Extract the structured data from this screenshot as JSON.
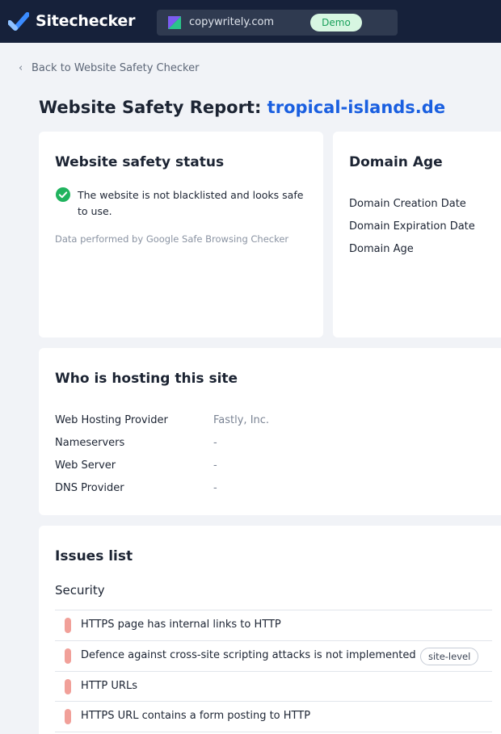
{
  "header": {
    "brand": "Sitechecker",
    "project": "copywritely.com",
    "demo_badge": "Demo"
  },
  "back_link": "Back to Website Safety Checker",
  "title": {
    "prefix": "Website Safety Report:",
    "domain": "tropical-islands.de"
  },
  "safety": {
    "heading": "Website safety status",
    "status_text": "The website is not blacklisted and looks safe to use.",
    "source": "Data performed by Google Safe Browsing Checker"
  },
  "domain_age": {
    "heading": "Domain Age",
    "rows": [
      "Domain Creation Date",
      "Domain Expiration Date",
      "Domain Age"
    ]
  },
  "hosting": {
    "heading": "Who is hosting this site",
    "rows": [
      {
        "label": "Web Hosting Provider",
        "value": "Fastly, Inc."
      },
      {
        "label": "Nameservers",
        "value": "-"
      },
      {
        "label": "Web Server",
        "value": "-"
      },
      {
        "label": "DNS Provider",
        "value": "-"
      }
    ]
  },
  "issues": {
    "heading": "Issues list",
    "section": "Security",
    "items": [
      {
        "text": "HTTPS page has internal links to HTTP",
        "badge": ""
      },
      {
        "text": "Defence against cross-site scripting attacks is not implemented",
        "badge": "site-level"
      },
      {
        "text": "HTTP URLs",
        "badge": ""
      },
      {
        "text": "HTTPS URL contains a form posting to HTTP",
        "badge": ""
      }
    ]
  },
  "colors": {
    "topbar": "#16213a",
    "accent_link": "#1a5fe0",
    "safe_green": "#20b35e",
    "issue_marker": "#f1a099"
  },
  "icons": {
    "logo": "sitechecker-check-logo",
    "project": "project-favicon",
    "back": "chevron-left-icon",
    "status": "check-circle-icon"
  }
}
